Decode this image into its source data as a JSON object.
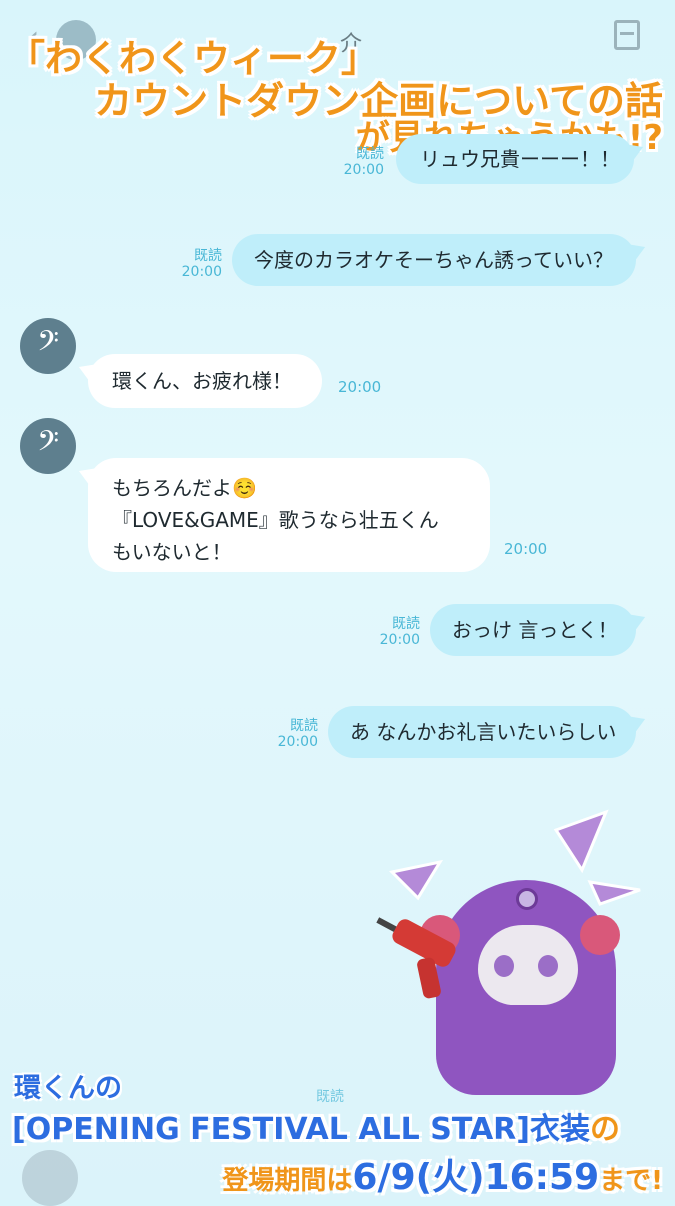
{
  "header": {
    "back_icon": "chevron-left-icon",
    "contact_name_partial": "介",
    "menu_icon": "menu-icon"
  },
  "promo": {
    "line1": "「わくわくウィーク」",
    "line2": "カウントダウン企画についての話",
    "line3": "が見れちゃうかも!?"
  },
  "messages": [
    {
      "side": "me",
      "text": "リュウ兄貴ーーー！！",
      "read": "既読",
      "time": "20:00"
    },
    {
      "side": "me",
      "text": "今度のカラオケそーちゃん誘っていい？",
      "read": "既読",
      "time": "20:00"
    },
    {
      "side": "them",
      "text": "環くん、お疲れ様！",
      "time": "20:00",
      "avatar_glyph": "𝄢"
    },
    {
      "side": "them",
      "lines": [
        "もちろんだよ☺️",
        "『LOVE&GAME』歌うなら壮五くん",
        "もいないと！"
      ],
      "time": "20:00",
      "avatar_glyph": "𝄢"
    },
    {
      "side": "me",
      "text": "おっけ 言っとく！",
      "read": "既読",
      "time": "20:00"
    },
    {
      "side": "me",
      "text": "あ なんかお礼言いたいらしい",
      "read": "既読",
      "time": "20:00"
    }
  ],
  "faded_read": "既読",
  "footer": {
    "line1": "環くんの",
    "line2_main": "[OPENING FESTIVAL ALL STAR]衣装",
    "line2_suffix": "の",
    "line3_prefix": "登場期間は",
    "line3_date": "6/9(火)16:59",
    "line3_suffix": "まで!"
  },
  "colors": {
    "accent_orange": "#f0951a",
    "accent_blue": "#2d6de0",
    "my_bubble": "#bfeefa",
    "their_bubble": "#ffffff",
    "read_text": "#49b7d6"
  }
}
